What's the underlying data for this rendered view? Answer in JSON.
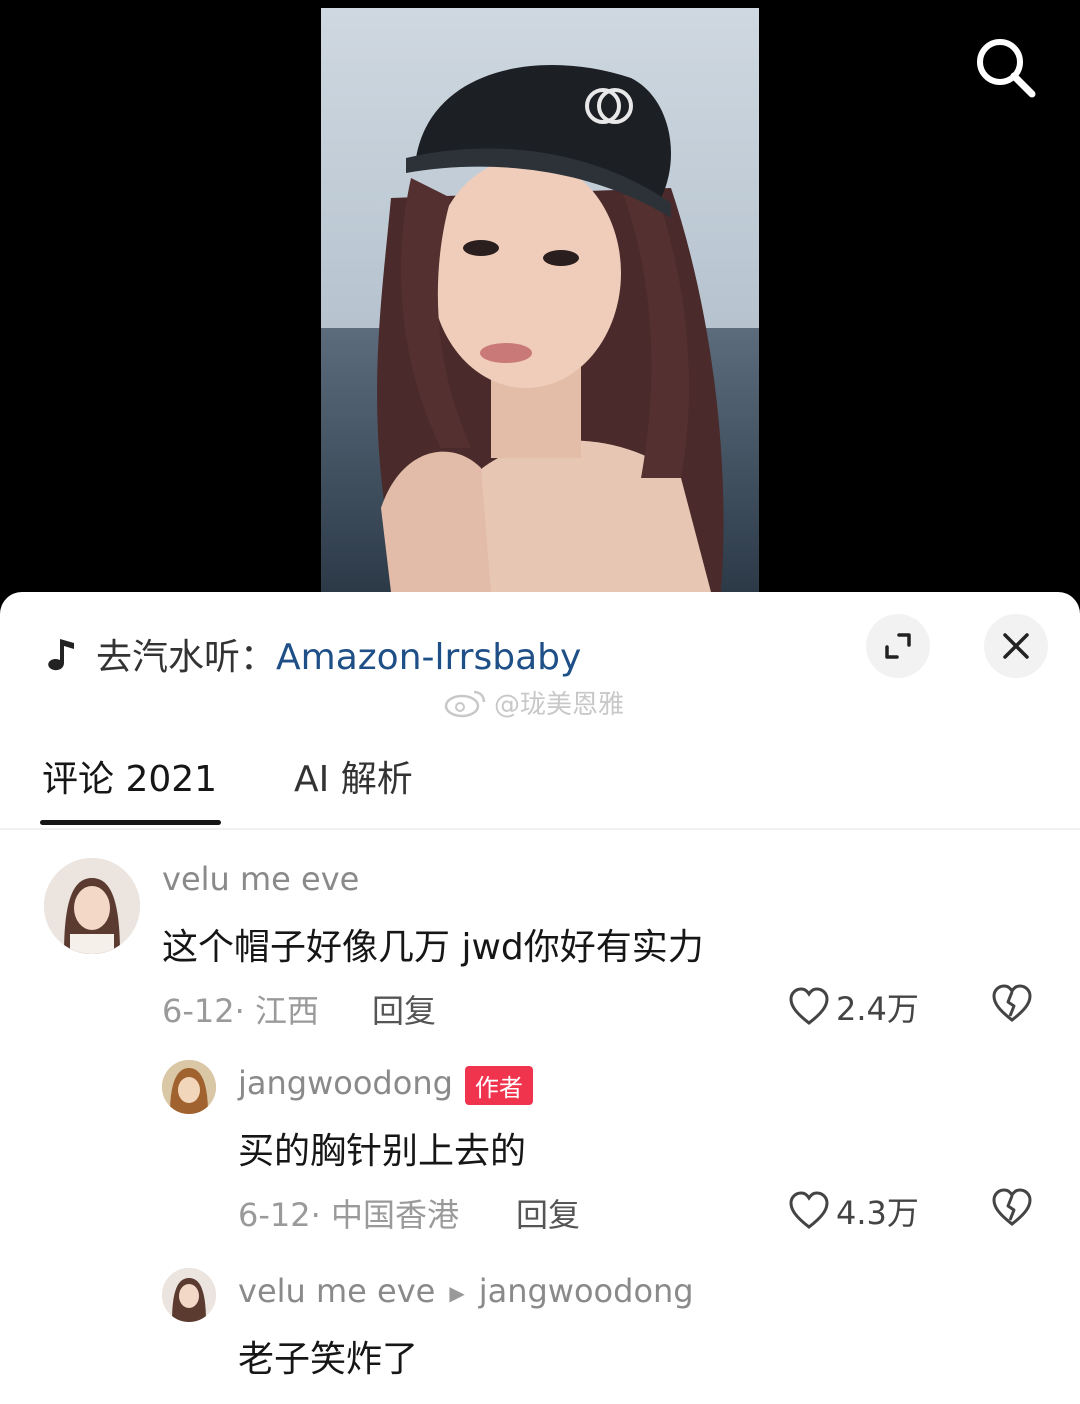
{
  "video": {
    "search_icon": "search-icon"
  },
  "music": {
    "prefix": "去汽水听：",
    "track": "Amazon-lrrsbaby",
    "icon": "music-note-icon"
  },
  "panel": {
    "expand_icon": "expand-icon",
    "close_icon": "close-icon"
  },
  "watermark": {
    "text": "@珑美恩雅"
  },
  "tabs": [
    {
      "label": "评论 2021",
      "active": true
    },
    {
      "label": "AI 解析",
      "active": false
    }
  ],
  "comments": [
    {
      "user": "velu me eve",
      "text": "这个帽子好像几万 jwd你好有实力",
      "meta": "6-12· 江西",
      "reply": "回复",
      "likes": "2.4万"
    },
    {
      "user": "jangwoodong",
      "badge": "作者",
      "text": "买的胸针别上去的",
      "meta": "6-12· 中国香港",
      "reply": "回复",
      "likes": "4.3万"
    },
    {
      "user": "velu me eve",
      "reply_to": "jangwoodong",
      "text": "老子笑炸了"
    }
  ],
  "colors": {
    "link": "#1f4f87",
    "badge": "#f0344e",
    "tab_indicator": "#161616"
  }
}
